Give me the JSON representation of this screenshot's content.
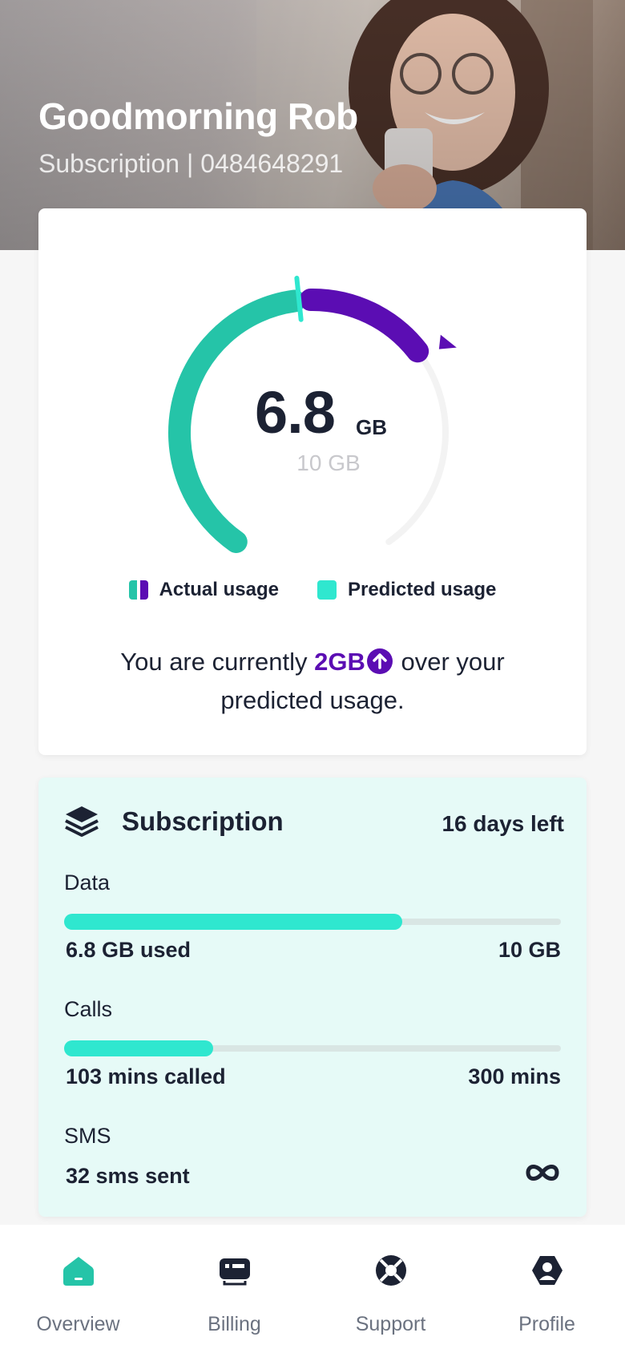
{
  "header": {
    "greeting": "Goodmorning Rob",
    "subline": "Subscription | 0484648291"
  },
  "usage": {
    "value": "6.8",
    "unit": "GB",
    "total": "10 GB",
    "used_gb": 6.8,
    "limit_gb": 10,
    "predicted_gb": 4.8,
    "legend": {
      "actual": "Actual usage",
      "predicted": "Predicted usage"
    },
    "message": {
      "prefix": "You are currently",
      "amount": "2GB",
      "suffix": "over your predicted usage."
    }
  },
  "subscription": {
    "title": "Subscription",
    "days_left": "16 days left",
    "data": {
      "label": "Data",
      "used": "6.8 GB used",
      "limit": "10 GB",
      "fraction": 0.68
    },
    "calls": {
      "label": "Calls",
      "used": "103 mins called",
      "limit": "300 mins",
      "fraction": 0.3
    },
    "sms": {
      "label": "SMS",
      "used": "32 sms sent",
      "limit_icon": "infinity-icon"
    }
  },
  "nav": {
    "items": [
      {
        "label": "Overview",
        "icon": "home-icon",
        "active": true
      },
      {
        "label": "Billing",
        "icon": "billing-icon",
        "active": false
      },
      {
        "label": "Support",
        "icon": "support-icon",
        "active": false
      },
      {
        "label": "Profile",
        "icon": "profile-icon",
        "active": false
      }
    ]
  },
  "colors": {
    "accent_teal": "#25c4a8",
    "predicted_teal": "#2fe7cf",
    "accent_purple": "#5b0db3",
    "text_dark": "#1c2233"
  }
}
